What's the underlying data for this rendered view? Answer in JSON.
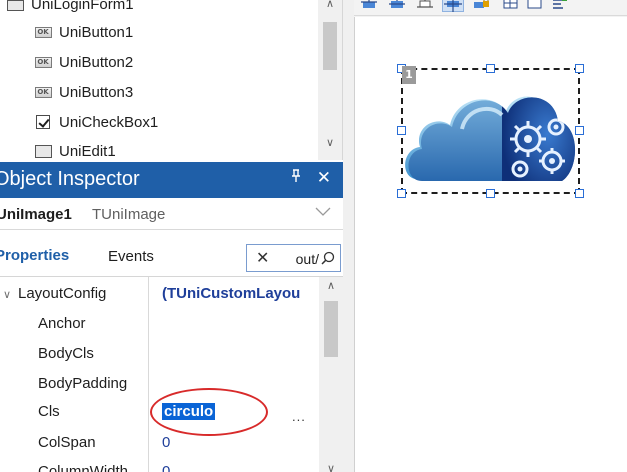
{
  "structure_tree": {
    "items": [
      {
        "label": "UniLoginForm1",
        "icon": "form-icon"
      },
      {
        "label": "UniButton1",
        "icon": "button-icon"
      },
      {
        "label": "UniButton2",
        "icon": "button-icon"
      },
      {
        "label": "UniButton3",
        "icon": "button-icon"
      },
      {
        "label": "UniCheckBox1",
        "icon": "checkbox-icon"
      },
      {
        "label": "UniEdit1",
        "icon": "edit-icon"
      }
    ],
    "button_icon_text": "OK"
  },
  "object_inspector": {
    "title": "Object Inspector",
    "pin_glyph": "ѱ",
    "close_glyph": "✕",
    "component_name": "UniImage1",
    "component_type": "TUniImage",
    "tabs": {
      "properties": "Properties",
      "events": "Events"
    },
    "search": {
      "value": "Layout",
      "visible_text": "/out"
    },
    "properties": [
      {
        "name": "LayoutConfig",
        "value": "(TUniCustomLayou",
        "expandable": true,
        "level": 0
      },
      {
        "name": "Anchor",
        "value": "",
        "level": 1
      },
      {
        "name": "BodyCls",
        "value": "",
        "level": 1
      },
      {
        "name": "BodyPadding",
        "value": "",
        "level": 1
      },
      {
        "name": "Cls",
        "value": "circulo",
        "level": 1,
        "selected": true,
        "ellipsis": "..."
      },
      {
        "name": "ColSpan",
        "value": "0",
        "level": 1
      },
      {
        "name": "ColumnWidth",
        "value": "0",
        "level": 1
      }
    ]
  },
  "designer": {
    "selected_tag": "1",
    "accent_color": "#2a6ed6"
  },
  "colors": {
    "header_blue": "#1f5fa8",
    "selection_blue": "#0a64d6",
    "annotation_red": "#d82a2a"
  }
}
